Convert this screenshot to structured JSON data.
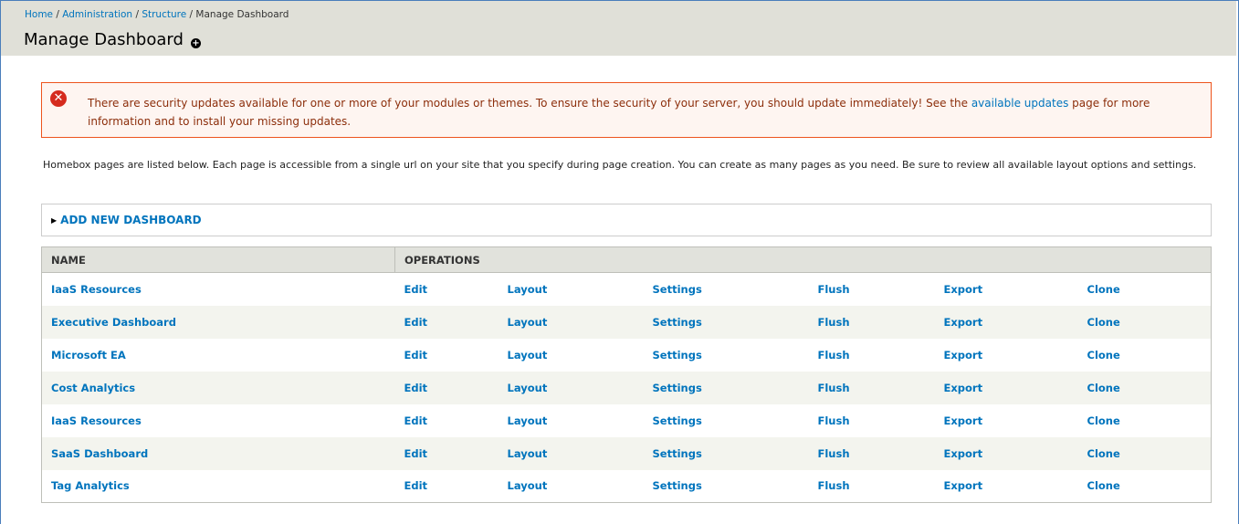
{
  "breadcrumb": {
    "items": [
      "Home",
      "Administration",
      "Structure"
    ],
    "separator": "/",
    "current": "Manage Dashboard"
  },
  "page": {
    "title": "Manage Dashboard",
    "add_shortcut_icon": "+"
  },
  "alert": {
    "icon": "error-icon",
    "text_before": "There are security updates available for one or more of your modules or themes. To ensure the security of your server, you should update immediately! See the ",
    "link": "available updates",
    "text_after": " page for more information and to install your missing updates."
  },
  "description": "Homebox pages are listed below. Each page is accessible from a single url on your site that you specify during page creation. You can create as many pages as you need. Be sure to review all available layout options and settings.",
  "add_new": {
    "label": "ADD NEW DASHBOARD"
  },
  "table": {
    "headers": [
      "NAME",
      "OPERATIONS"
    ],
    "operations": [
      "Edit",
      "Layout",
      "Settings",
      "Flush",
      "Export",
      "Clone"
    ],
    "rows": [
      "IaaS Resources",
      "Executive Dashboard",
      "Microsoft EA",
      "Cost Analytics",
      "IaaS Resources",
      "SaaS Dashboard",
      "Tag Analytics"
    ]
  },
  "colors": {
    "link": "#0074bd",
    "header_bg": "#e0e0d8",
    "alert_bg": "#fef5f1",
    "alert_border": "#ed541d",
    "alert_text": "#8c2e0b",
    "row_even": "#f3f4ee"
  }
}
